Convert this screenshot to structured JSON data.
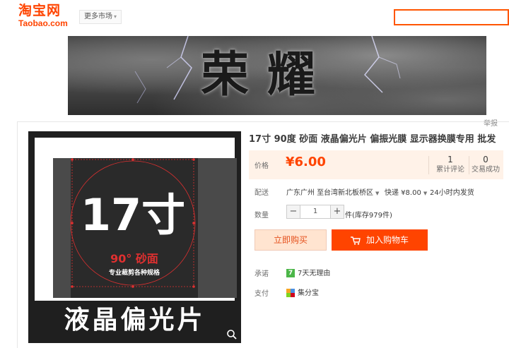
{
  "header": {
    "logo_main": "淘宝网",
    "logo_sub": "Taobao.com",
    "more_market": "更多市场"
  },
  "banner": {
    "text": "荣耀"
  },
  "report_label": "举报",
  "product": {
    "title": "17寸 90度 砂面 液晶偏光片 偏振光膜 显示器换膜专用 批发",
    "image_text": {
      "size_text": "17寸",
      "angle_text": "90° 砂面",
      "subtitle": "专业裁剪各种规格",
      "bottom_text": "液晶偏光片"
    },
    "price_label": "价格",
    "price": "¥6.00",
    "reviews": {
      "count": "1",
      "label": "累计评论"
    },
    "sales": {
      "count": "0",
      "label": "交易成功"
    },
    "shipping": {
      "label": "配送",
      "origin": "广东广州 至",
      "destination": "台湾新北板桥区",
      "method": "快递 ¥8.00",
      "dispatch": "24小时内发货"
    },
    "quantity": {
      "label": "数量",
      "value": "1",
      "minus": "−",
      "plus": "+",
      "stock": "件(库存979件)"
    },
    "buy_now": "立即购买",
    "add_to_cart": "加入购物车",
    "promise": {
      "label": "承诺",
      "badge": "7",
      "text": "7天无理由"
    },
    "payment": {
      "label": "支付",
      "text": "集分宝"
    }
  },
  "colors": {
    "accent": "#ff4400",
    "price_bg": "#fff2e8"
  }
}
